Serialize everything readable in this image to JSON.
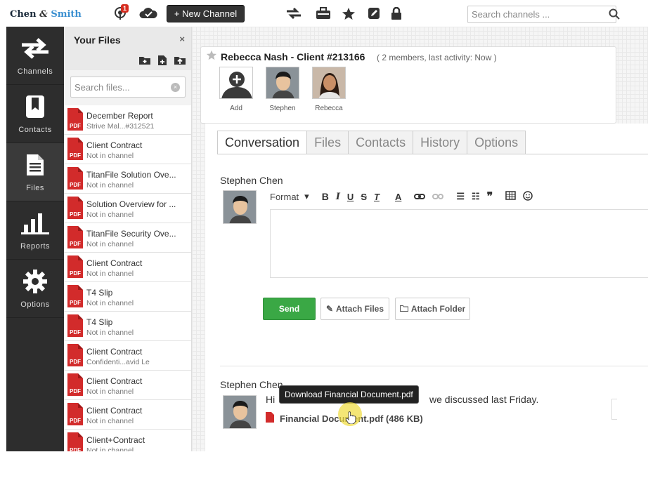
{
  "app": {
    "logo": {
      "part1": "Chen",
      "amp": "&",
      "part2": "Smith"
    },
    "notification_count": "1",
    "new_channel_label": "+ New Channel",
    "search_placeholder": "Search channels ..."
  },
  "nav": {
    "items": [
      {
        "label": "Channels",
        "icon": "swap-arrows-icon"
      },
      {
        "label": "Contacts",
        "icon": "bookmark-icon"
      },
      {
        "label": "Files",
        "icon": "document-icon"
      },
      {
        "label": "Reports",
        "icon": "bar-chart-icon"
      },
      {
        "label": "Options",
        "icon": "gear-icon"
      }
    ],
    "active": "Files"
  },
  "files_panel": {
    "title": "Your Files",
    "close": "×",
    "search_placeholder": "Search files...",
    "files": [
      {
        "name": "December Report",
        "sub": "Strive Mal...#312521"
      },
      {
        "name": "Client Contract",
        "sub": "Not in channel"
      },
      {
        "name": "TitanFile Solution Ove...",
        "sub": "Not in channel"
      },
      {
        "name": "Solution Overview for ...",
        "sub": "Not in channel"
      },
      {
        "name": "TitanFile Security Ove...",
        "sub": "Not in channel"
      },
      {
        "name": "Client Contract",
        "sub": "Not in channel"
      },
      {
        "name": "T4 Slip",
        "sub": "Not in channel"
      },
      {
        "name": "T4 Slip",
        "sub": "Not in channel"
      },
      {
        "name": "Client Contract",
        "sub": "Confidenti...avid Le"
      },
      {
        "name": "Client Contract",
        "sub": "Not in channel"
      },
      {
        "name": "Client Contract",
        "sub": "Not in channel"
      },
      {
        "name": "Client+Contract",
        "sub": "Not in channel"
      }
    ],
    "pdf_label": "PDF"
  },
  "channel": {
    "title": "Rebecca Nash - Client #213166",
    "meta": "( 2 members, last activity: Now )",
    "members": [
      {
        "name": "Add"
      },
      {
        "name": "Stephen"
      },
      {
        "name": "Rebecca"
      }
    ]
  },
  "tabs": [
    "Conversation",
    "Files",
    "Contacts",
    "History",
    "Options"
  ],
  "composer": {
    "author": "Stephen Chen",
    "format_label": "Format",
    "send_label": "Send",
    "attach_files_label": "Attach Files",
    "attach_folder_label": "Attach Folder"
  },
  "message": {
    "author": "Stephen Chen",
    "text_start": "Hi",
    "text_end": "we discussed last Friday.",
    "file_label": "Financial Document.pdf (486 KB)",
    "tooltip": "Download Financial Document.pdf"
  },
  "colors": {
    "nav_bg": "#2d2d2d",
    "send_green": "#3aa845",
    "pdf_red": "#d22b2b",
    "logo_blue": "#3a8fd0"
  }
}
